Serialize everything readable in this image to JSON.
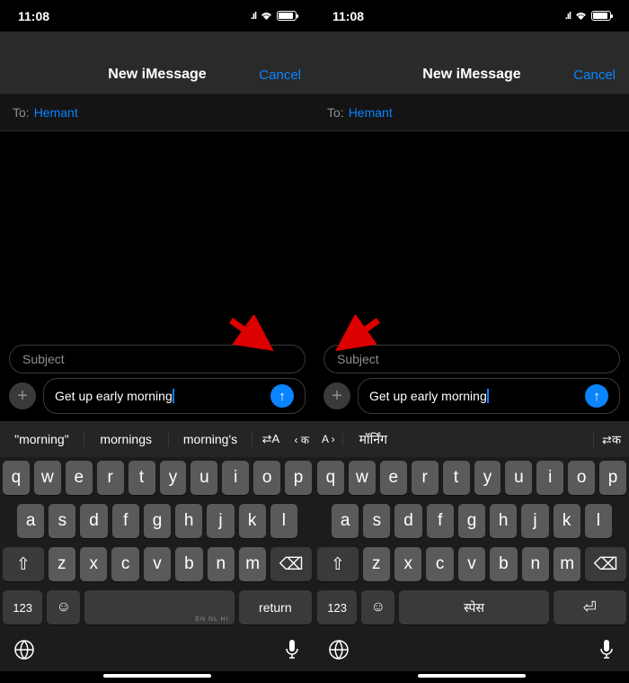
{
  "statusTime": "11:08",
  "header": {
    "title": "New iMessage",
    "cancel": "Cancel"
  },
  "to": {
    "label": "To:",
    "value": "Hemant"
  },
  "compose": {
    "subjectPlaceholder": "Subject",
    "messageText": "Get up early morning"
  },
  "left": {
    "predictions": [
      "\"morning\"",
      "mornings",
      "morning's"
    ],
    "langSwitchIcon": "⇄A",
    "langHint": "‹ क",
    "spaceLangs": "EN NL HI",
    "return": "return"
  },
  "right": {
    "langExitIcon": "A ›",
    "prediction": "मॉर्निंग",
    "langSwitchIcon": "⇄क",
    "space": "स्पेस"
  },
  "keys": {
    "row1": [
      "q",
      "w",
      "e",
      "r",
      "t",
      "y",
      "u",
      "i",
      "o",
      "p"
    ],
    "row2": [
      "a",
      "s",
      "d",
      "f",
      "g",
      "h",
      "j",
      "k",
      "l"
    ],
    "row3": [
      "z",
      "x",
      "c",
      "v",
      "b",
      "n",
      "m"
    ],
    "shift": "⇧",
    "backspace": "⌫",
    "num": "123",
    "emoji": "☺",
    "returnArrow": "⏎",
    "globe": "🌐",
    "mic": "🎤"
  }
}
